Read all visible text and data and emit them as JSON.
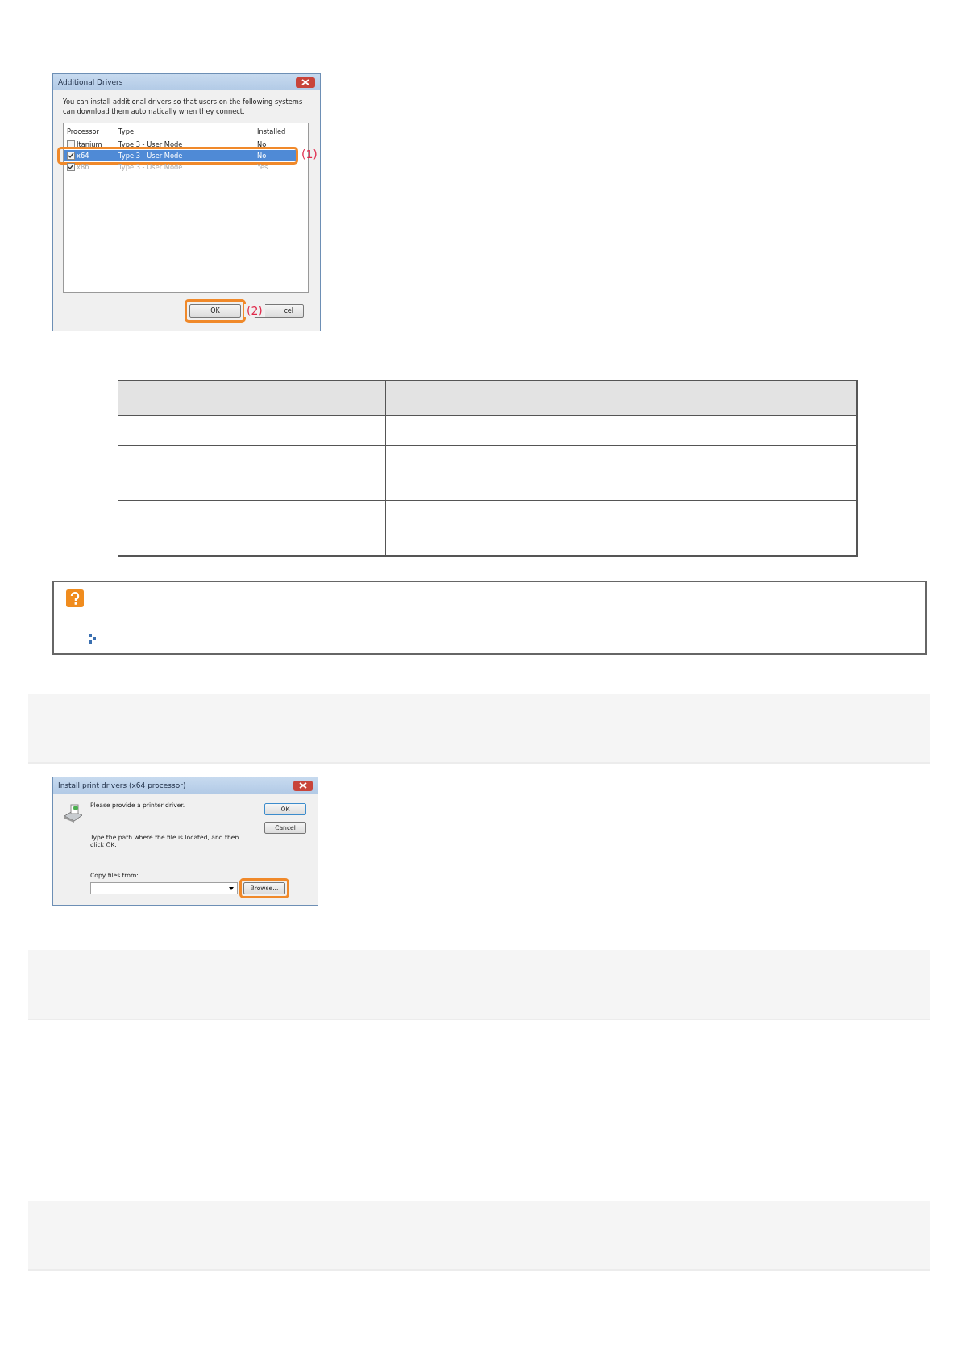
{
  "additional_drivers_dialog": {
    "title": "Additional Drivers",
    "description": "You can install additional drivers so that users on the following systems can download them automatically when they connect.",
    "columns": [
      "Processor",
      "Type",
      "Installed"
    ],
    "rows": [
      {
        "processor": "Itanium",
        "type": "Type 3 - User Mode",
        "installed": "No",
        "checked": false,
        "selected": false,
        "disabled": false,
        "highlighted": false
      },
      {
        "processor": "x64",
        "type": "Type 3 - User Mode",
        "installed": "No",
        "checked": true,
        "selected": true,
        "disabled": false,
        "highlighted": true
      },
      {
        "processor": "x86",
        "type": "Type 3 - User Mode",
        "installed": "Yes",
        "checked": true,
        "selected": false,
        "disabled": true,
        "highlighted": false
      }
    ],
    "row_callout": "(1)",
    "buttons": [
      {
        "label": "OK",
        "highlighted": true,
        "callout": "(2)"
      },
      {
        "label": "cel",
        "highlighted": false
      }
    ]
  },
  "install_dialog": {
    "title": "Install print drivers (x64 processor)",
    "message": "Please provide a printer driver.",
    "instruction": "Type the path where the file is located, and then click OK.",
    "copy_label": "Copy files from:",
    "buttons": [
      {
        "label": "OK",
        "highlighted": false
      },
      {
        "label": "Cancel",
        "highlighted": false
      }
    ],
    "browse": {
      "label": "Browse...",
      "highlighted": true
    }
  }
}
